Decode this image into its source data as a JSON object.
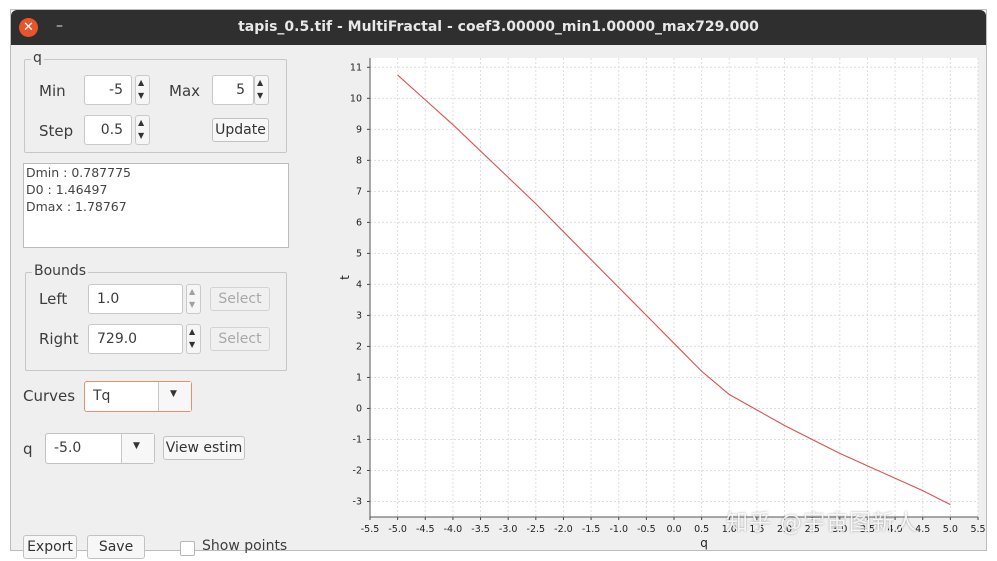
{
  "window": {
    "title": "tapis_0.5.tif - MultiFractal - coef3.00000_min1.00000_max729.000"
  },
  "q_group": {
    "title": "q",
    "min_label": "Min",
    "min_value": "-5",
    "max_label": "Max",
    "max_value": "5",
    "step_label": "Step",
    "step_value": "0.5",
    "update_label": "Update"
  },
  "results": [
    "Dmin : 0.787775",
    "D0 : 1.46497",
    "Dmax : 1.78767"
  ],
  "bounds": {
    "title": "Bounds",
    "left_label": "Left",
    "left_value": "1.0",
    "right_label": "Right",
    "right_value": "729.0",
    "select_label": "Select"
  },
  "curves": {
    "label": "Curves",
    "value": "Tq"
  },
  "qsel": {
    "label": "q",
    "value": "-5.0",
    "view_label": "View estim"
  },
  "bottom": {
    "export_label": "Export",
    "save_label": "Save",
    "show_points_label": "Show points",
    "show_points_checked": false
  },
  "watermark": "知乎 @宇宙图新人",
  "chart_data": {
    "type": "line",
    "xlabel": "q",
    "ylabel": "t",
    "xlim": [
      -5.5,
      5.5
    ],
    "ylim": [
      -3.5,
      11.3
    ],
    "xticks": [
      "-5.5",
      "-5.0",
      "-4.5",
      "-4.0",
      "-3.5",
      "-3.0",
      "-2.5",
      "-2.0",
      "-1.5",
      "-1.0",
      "-0.5",
      "0.0",
      "0.5",
      "1.0",
      "1.5",
      "2.0",
      "2.5",
      "3.0",
      "3.5",
      "4.0",
      "4.5",
      "5.0",
      "5.5"
    ],
    "yticks": [
      "-3",
      "-2",
      "-1",
      "0",
      "1",
      "2",
      "3",
      "4",
      "5",
      "6",
      "7",
      "8",
      "9",
      "10",
      "11"
    ],
    "grid": true,
    "line_color": "#d9534f",
    "series": [
      {
        "x": [
          -5.0,
          -4.5,
          -4.0,
          -3.5,
          -3.0,
          -2.5,
          -2.0,
          -1.5,
          -1.0,
          -0.5,
          0.0,
          0.5,
          1.0,
          1.5,
          2.0,
          2.5,
          3.0,
          3.5,
          4.0,
          4.5,
          5.0
        ],
        "y": [
          10.75,
          9.95,
          9.15,
          8.3,
          7.45,
          6.6,
          5.7,
          4.8,
          3.9,
          3.0,
          2.1,
          1.2,
          0.45,
          -0.05,
          -0.55,
          -1.0,
          -1.45,
          -1.85,
          -2.25,
          -2.65,
          -3.1
        ]
      }
    ]
  }
}
